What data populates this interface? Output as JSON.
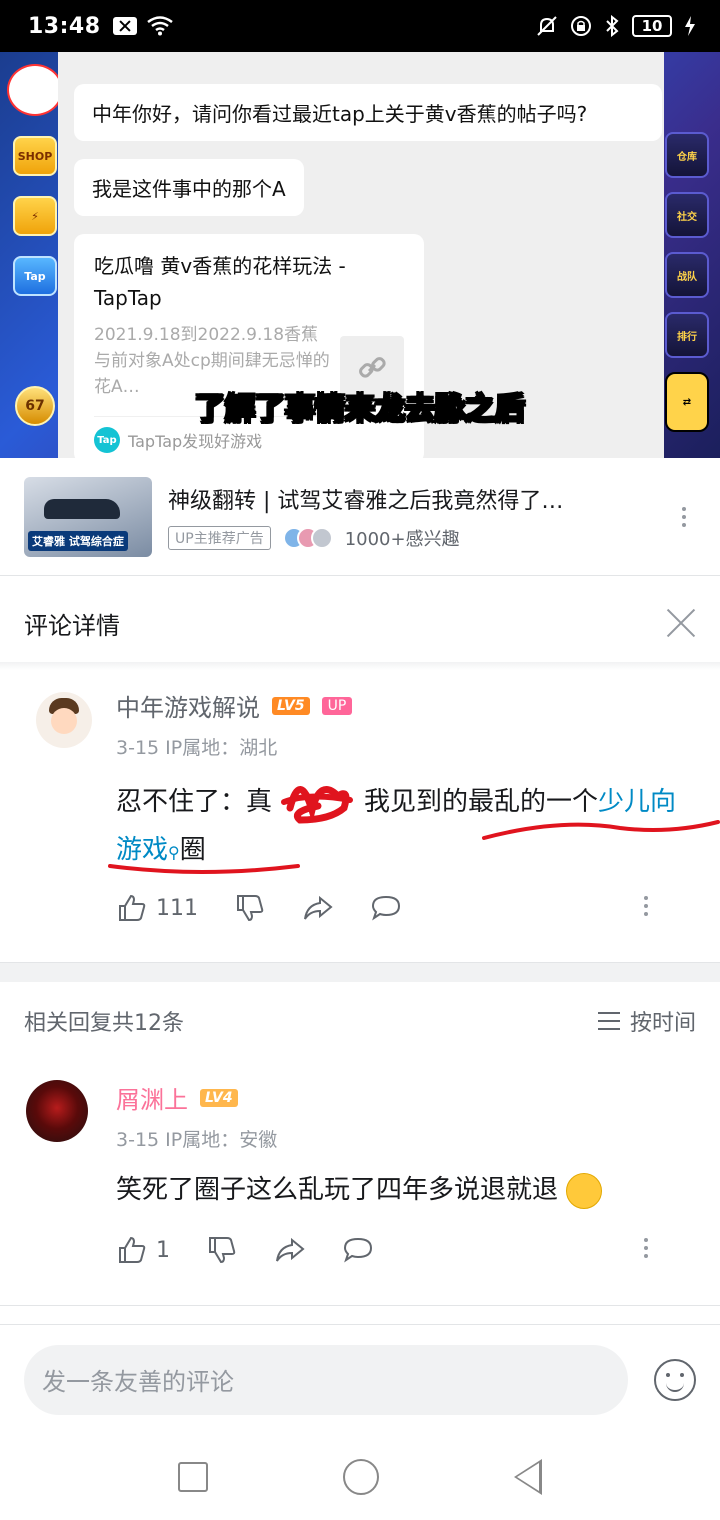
{
  "status_bar": {
    "time": "13:48",
    "battery": "10",
    "icons": [
      "notification-box-icon",
      "wifi-icon",
      "mute-bell-icon",
      "rotation-lock-icon",
      "bluetooth-icon",
      "charging-icon"
    ]
  },
  "video": {
    "chat": {
      "msg1": "中年你好，请问你看过最近tap上关于黄v香蕉的帖子吗?",
      "msg2": "我是这件事中的那个A",
      "card_title": "吃瓜噜 黄v香蕉的花样玩法 - TapTap",
      "card_desc": "2021.9.18到2022.9.18香蕉与前对象A处cp期间肆无忌惮的花A…",
      "card_source": "TapTap发现好游戏",
      "tap_logo": "Tap"
    },
    "subtitle": "了解了事情来龙去脉之后",
    "game_left": [
      "SHOP",
      "⚡",
      "Tap",
      "67"
    ],
    "game_right": [
      "仓库",
      "社交",
      "战队",
      "排行",
      "⇄"
    ]
  },
  "ad": {
    "title": "神级翻转 | 试驾艾睿雅之后我竟然得了…",
    "thumb_tag": "艾睿雅 试驾综合症",
    "badge": "UP主推荐广告",
    "interest": "1000+感兴趣"
  },
  "detail": {
    "title": "评论详情"
  },
  "main_comment": {
    "username": "中年游戏解说",
    "level": "LV5",
    "up_badge": "UP",
    "meta": "3-15  IP属地：湖北",
    "text_before": "忍不住了：真",
    "text_middle": "我见到的最乱的一个",
    "text_link": "少儿向游戏",
    "text_after": "圈",
    "likes": "111"
  },
  "replies": {
    "count_label": "相关回复共12条",
    "sort_label": "按时间"
  },
  "reply1": {
    "username": "屑渊上",
    "level": "LV4",
    "meta": "3-15  IP属地：安徽",
    "text": "笑死了圈子这么乱玩了四年多说退就退",
    "likes": "1"
  },
  "input": {
    "placeholder": "发一条友善的评论"
  },
  "colors": {
    "link": "#008ac5",
    "pink": "#fb7299",
    "annotation_red": "#e0141e"
  }
}
